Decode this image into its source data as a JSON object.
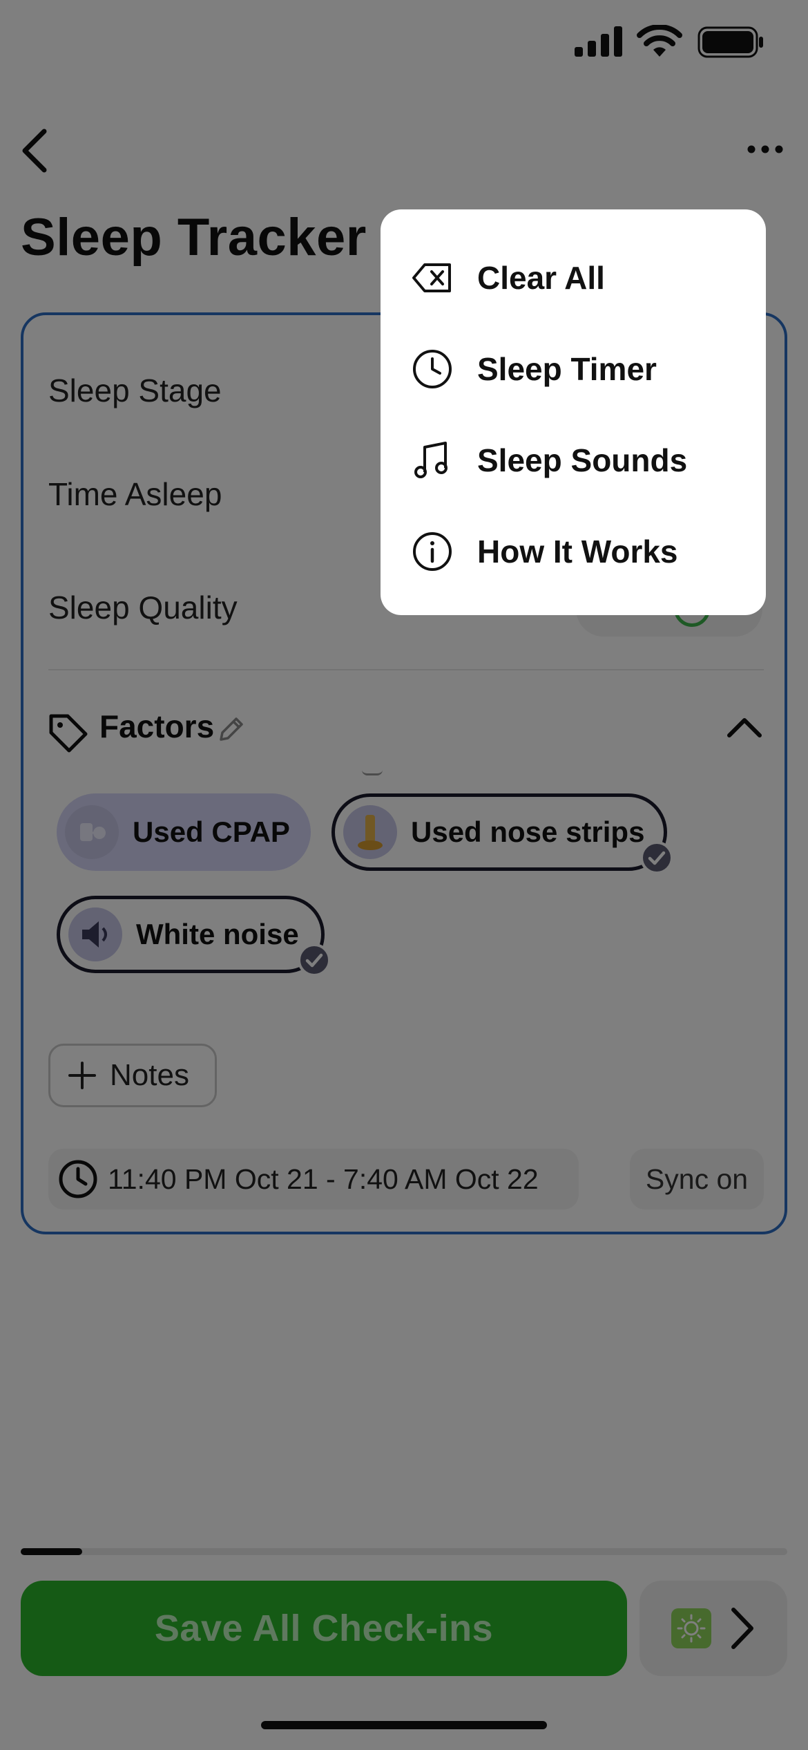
{
  "header": {
    "title": "Sleep Tracker"
  },
  "card": {
    "rows": [
      {
        "label": "Sleep Stage"
      },
      {
        "label": "Time Asleep"
      },
      {
        "label": "Sleep Quality"
      }
    ],
    "factors": {
      "label": "Factors",
      "chips": [
        {
          "label": "Used CPAP",
          "selected": false
        },
        {
          "label": "Used nose strips",
          "selected": true
        },
        {
          "label": "White noise",
          "selected": true
        }
      ]
    },
    "notes_label": "Notes",
    "time_range": "11:40 PM Oct 21 - 7:40 AM Oct 22",
    "sync_label": "Sync on"
  },
  "footer": {
    "progress_fraction": 0.08,
    "save_label": "Save All Check-ins"
  },
  "menu": {
    "items": [
      {
        "label": "Clear All",
        "icon": "backspace-icon"
      },
      {
        "label": "Sleep Timer",
        "icon": "clock-icon"
      },
      {
        "label": "Sleep Sounds",
        "icon": "music-note-icon"
      },
      {
        "label": "How It Works",
        "icon": "info-icon"
      }
    ]
  },
  "colors": {
    "accent_border": "#2d6dc2",
    "save_button": "#2ab52a",
    "chip_plain": "#d5d5f7"
  }
}
